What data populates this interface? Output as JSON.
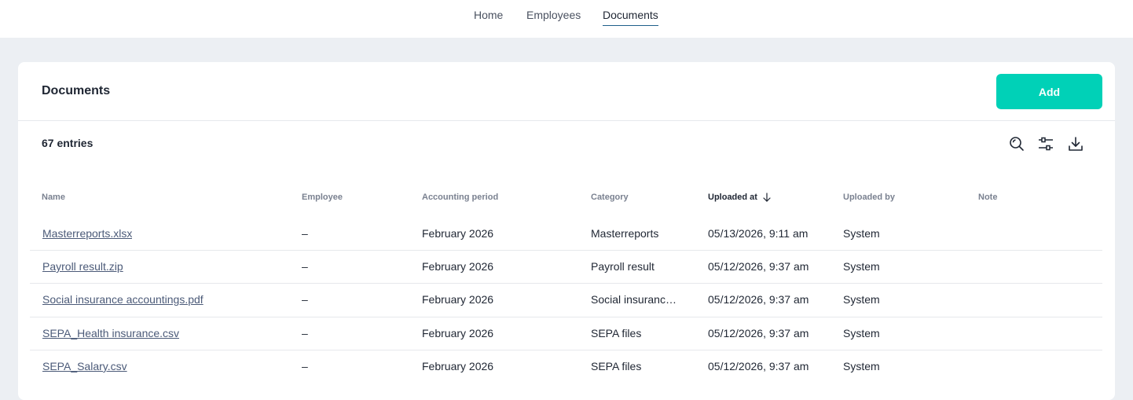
{
  "nav": {
    "items": [
      {
        "label": "Home"
      },
      {
        "label": "Employees"
      },
      {
        "label": "Documents",
        "active": true
      }
    ]
  },
  "card": {
    "title": "Documents",
    "add_label": "Add",
    "entries": "67 entries"
  },
  "toolbar": {
    "icons": [
      "search-icon",
      "filter-sliders-icon",
      "download-icon"
    ]
  },
  "table": {
    "headers": {
      "name": "Name",
      "employee": "Employee",
      "period": "Accounting period",
      "category": "Category",
      "uploaded_at": "Uploaded at",
      "uploaded_by": "Uploaded by",
      "note": "Note"
    },
    "sorted_column": "uploaded_at",
    "sort_direction": "descending",
    "rows": [
      {
        "name": "Masterreports.xlsx",
        "employee": "–",
        "period": "February 2026",
        "category": "Masterreports",
        "uploaded_at": "05/13/2026, 9:11 am",
        "uploaded_by": "System",
        "note": ""
      },
      {
        "name": "Payroll result.zip",
        "employee": "–",
        "period": "February 2026",
        "category": "Payroll result",
        "uploaded_at": "05/12/2026, 9:37 am",
        "uploaded_by": "System",
        "note": ""
      },
      {
        "name": "Social insurance accountings.pdf",
        "employee": "–",
        "period": "February 2026",
        "category": "Social insurance accountings",
        "uploaded_at": "05/12/2026, 9:37 am",
        "uploaded_by": "System",
        "note": ""
      },
      {
        "name": "SEPA_Health insurance.csv",
        "employee": "–",
        "period": "February 2026",
        "category": "SEPA files",
        "uploaded_at": "05/12/2026, 9:37 am",
        "uploaded_by": "System",
        "note": ""
      },
      {
        "name": "SEPA_Salary.csv",
        "employee": "–",
        "period": "February 2026",
        "category": "SEPA files",
        "uploaded_at": "05/12/2026, 9:37 am",
        "uploaded_by": "System",
        "note": ""
      }
    ]
  },
  "colors": {
    "accent": "#00d1b7",
    "page_bg": "#eceff3",
    "active_underline": "#1f5f8a",
    "link": "#4b5a78"
  }
}
